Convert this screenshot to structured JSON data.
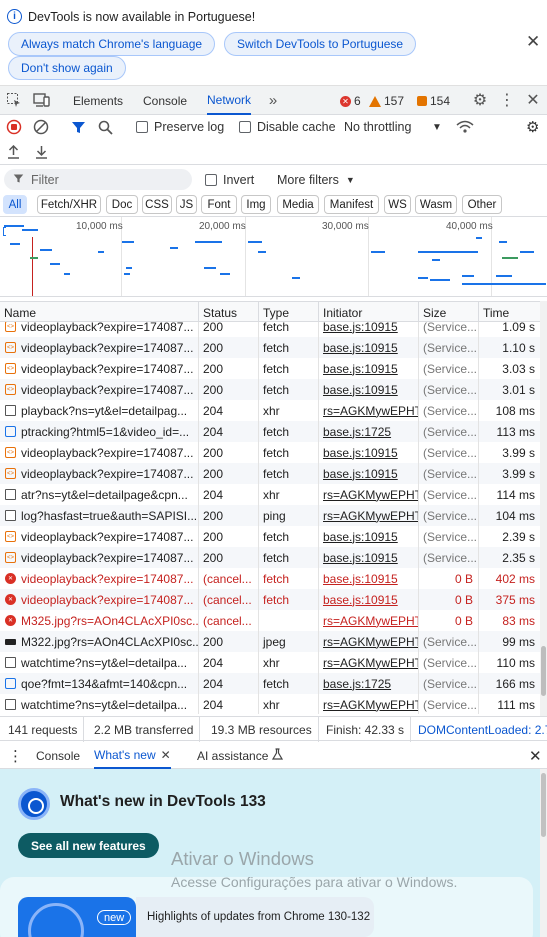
{
  "infobar": {
    "message": "DevTools is now available in Portuguese!",
    "btn_match": "Always match Chrome's language",
    "btn_switch": "Switch DevTools to Portuguese",
    "btn_dismiss": "Don't show again"
  },
  "toolbar": {
    "tabs": [
      "Elements",
      "Console",
      "Network"
    ],
    "active_tab": "Network",
    "errors": "6",
    "warnings": "157",
    "issues": "154"
  },
  "network": {
    "preserve_log": "Preserve log",
    "disable_cache": "Disable cache",
    "throttling": "No throttling",
    "filter_placeholder": "Filter",
    "invert": "Invert",
    "more_filters": "More filters",
    "chips": [
      "All",
      "Fetch/XHR",
      "Doc",
      "CSS",
      "JS",
      "Font",
      "Img",
      "Media",
      "Manifest",
      "WS",
      "Wasm",
      "Other"
    ]
  },
  "overview": {
    "ticks": [
      "10,000 ms",
      "20,000 ms",
      "30,000 ms",
      "40,000 ms"
    ]
  },
  "table": {
    "headers": [
      "Name",
      "Status",
      "Type",
      "Initiator",
      "Size",
      "Time"
    ],
    "rows": [
      {
        "name": "videoplayback?expire=174087...",
        "status": "200",
        "type": "fetch",
        "initiator": "base.js:10915",
        "size": "(Service...",
        "time": "1.09 s",
        "icon": "fetch",
        "err": false
      },
      {
        "name": "videoplayback?expire=174087...",
        "status": "200",
        "type": "fetch",
        "initiator": "base.js:10915",
        "size": "(Service...",
        "time": "1.10 s",
        "icon": "fetch",
        "err": false
      },
      {
        "name": "videoplayback?expire=174087...",
        "status": "200",
        "type": "fetch",
        "initiator": "base.js:10915",
        "size": "(Service...",
        "time": "3.03 s",
        "icon": "fetch",
        "err": false
      },
      {
        "name": "videoplayback?expire=174087...",
        "status": "200",
        "type": "fetch",
        "initiator": "base.js:10915",
        "size": "(Service...",
        "time": "3.01 s",
        "icon": "fetch",
        "err": false
      },
      {
        "name": "playback?ns=yt&el=detailpag...",
        "status": "204",
        "type": "xhr",
        "initiator": "rs=AGKMywEPHTI",
        "size": "(Service...",
        "time": "108 ms",
        "icon": "doc",
        "err": false
      },
      {
        "name": "ptracking?html5=1&video_id=...",
        "status": "204",
        "type": "fetch",
        "initiator": "base.js:1725",
        "size": "(Service...",
        "time": "113 ms",
        "icon": "xhr",
        "err": false
      },
      {
        "name": "videoplayback?expire=174087...",
        "status": "200",
        "type": "fetch",
        "initiator": "base.js:10915",
        "size": "(Service...",
        "time": "3.99 s",
        "icon": "fetch",
        "err": false
      },
      {
        "name": "videoplayback?expire=174087...",
        "status": "200",
        "type": "fetch",
        "initiator": "base.js:10915",
        "size": "(Service...",
        "time": "3.99 s",
        "icon": "fetch",
        "err": false
      },
      {
        "name": "atr?ns=yt&el=detailpage&cpn...",
        "status": "204",
        "type": "xhr",
        "initiator": "rs=AGKMywEPHTI",
        "size": "(Service...",
        "time": "114 ms",
        "icon": "doc",
        "err": false
      },
      {
        "name": "log?hasfast=true&auth=SAPISI...",
        "status": "200",
        "type": "ping",
        "initiator": "rs=AGKMywEPHTI",
        "size": "(Service...",
        "time": "104 ms",
        "icon": "doc",
        "err": false
      },
      {
        "name": "videoplayback?expire=174087...",
        "status": "200",
        "type": "fetch",
        "initiator": "base.js:10915",
        "size": "(Service...",
        "time": "2.39 s",
        "icon": "fetch",
        "err": false
      },
      {
        "name": "videoplayback?expire=174087...",
        "status": "200",
        "type": "fetch",
        "initiator": "base.js:10915",
        "size": "(Service...",
        "time": "2.35 s",
        "icon": "fetch",
        "err": false
      },
      {
        "name": "videoplayback?expire=174087...",
        "status": "(cancel...",
        "type": "fetch",
        "initiator": "base.js:10915",
        "size": "0 B",
        "time": "402 ms",
        "icon": "err",
        "err": true
      },
      {
        "name": "videoplayback?expire=174087...",
        "status": "(cancel...",
        "type": "fetch",
        "initiator": "base.js:10915",
        "size": "0 B",
        "time": "375 ms",
        "icon": "err",
        "err": true
      },
      {
        "name": "M325.jpg?rs=AOn4CLAcXPI0sc...",
        "status": "(cancel...",
        "type": "",
        "initiator": "rs=AGKMywEPHTI",
        "size": "0 B",
        "time": "83 ms",
        "icon": "err",
        "err": true
      },
      {
        "name": "M322.jpg?rs=AOn4CLAcXPI0sc...",
        "status": "200",
        "type": "jpeg",
        "initiator": "rs=AGKMywEPHTI",
        "size": "(Service...",
        "time": "99 ms",
        "icon": "img",
        "err": false
      },
      {
        "name": "watchtime?ns=yt&el=detailpa...",
        "status": "204",
        "type": "xhr",
        "initiator": "rs=AGKMywEPHTI",
        "size": "(Service...",
        "time": "110 ms",
        "icon": "doc",
        "err": false
      },
      {
        "name": "qoe?fmt=134&afmt=140&cpn...",
        "status": "204",
        "type": "fetch",
        "initiator": "base.js:1725",
        "size": "(Service...",
        "time": "166 ms",
        "icon": "xhr",
        "err": false
      },
      {
        "name": "watchtime?ns=yt&el=detailpa...",
        "status": "204",
        "type": "xhr",
        "initiator": "rs=AGKMywEPHTI",
        "size": "(Service...",
        "time": "111 ms",
        "icon": "doc",
        "err": false
      }
    ]
  },
  "statusbar": {
    "requests": "141 requests",
    "transferred": "2.2 MB transferred",
    "resources": "19.3 MB resources",
    "finish": "Finish: 42.33 s",
    "domcontent": "DOMContentLoaded: 2.7"
  },
  "drawer": {
    "tabs": [
      "Console",
      "What's new",
      "AI assistance"
    ],
    "active_tab": "What's new",
    "title": "What's new in DevTools 133",
    "button": "See all new features",
    "badge": "new",
    "highlight": "Highlights of updates from Chrome 130-132",
    "watermark_title": "Ativar o Windows",
    "watermark_sub": "Acesse Configurações para ativar o Windows."
  },
  "colors": {
    "accent": "#0b57d0",
    "error": "#c5221f",
    "whatsnew_bg": "#d4f0f7"
  }
}
